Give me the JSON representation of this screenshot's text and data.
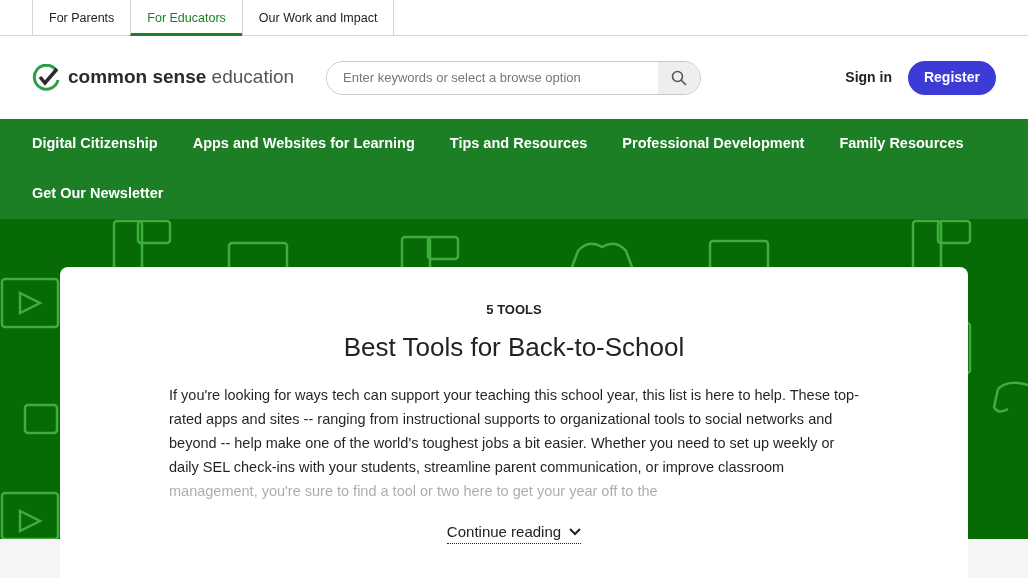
{
  "audience_tabs": [
    {
      "label": "For Parents",
      "selected": false
    },
    {
      "label": "For Educators",
      "selected": true
    },
    {
      "label": "Our Work and Impact",
      "selected": false
    }
  ],
  "header": {
    "logo_bold": "common sense",
    "logo_light": "education",
    "search": {
      "placeholder": "Enter keywords or select a browse option"
    },
    "sign_in": "Sign in",
    "register": "Register"
  },
  "main_nav": [
    "Digital Citizenship",
    "Apps and Websites for Learning",
    "Tips and Resources",
    "Professional Development",
    "Family Resources",
    "Get Our Newsletter"
  ],
  "article": {
    "eyebrow": "5 TOOLS",
    "title": "Best Tools for Back-to-School",
    "summary": "If you're looking for ways tech can support your teaching this school year, this list is here to help. These top-rated apps and sites -- ranging from instructional supports to organizational tools to social networks and beyond -- help make one of the world's toughest jobs a bit easier. Whether you need to set up weekly or daily SEL check-ins with your students, streamline parent communication, or improve classroom management, you're sure to find a tool or two here to get your year off to the",
    "continue": "Continue reading"
  }
}
